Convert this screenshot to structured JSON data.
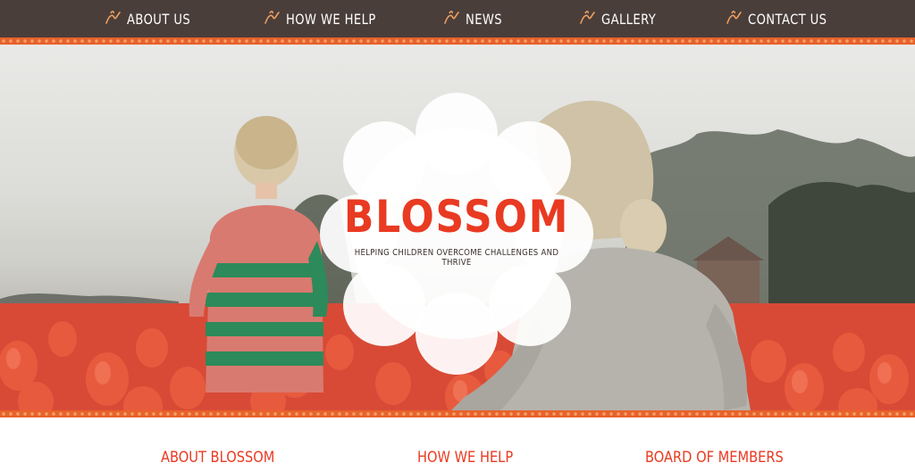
{
  "nav": {
    "items": [
      {
        "label": "About Us"
      },
      {
        "label": "How We Help"
      },
      {
        "label": "News"
      },
      {
        "label": "Gallery"
      },
      {
        "label": "Contact Us"
      }
    ]
  },
  "hero": {
    "logo_title": "BLOSSOM",
    "tagline": "Helping children overcome challenges and thrive"
  },
  "sections": {
    "about": "About Blossom",
    "help": "How We Help",
    "board": "Board of Members"
  },
  "colors": {
    "nav_bg": "#4a3e3a",
    "trim": "#e8622b",
    "accent_red": "#e93a22",
    "nav_icon": "#f0a060"
  },
  "icons": {
    "nav_item_icon": "flower-icon"
  }
}
